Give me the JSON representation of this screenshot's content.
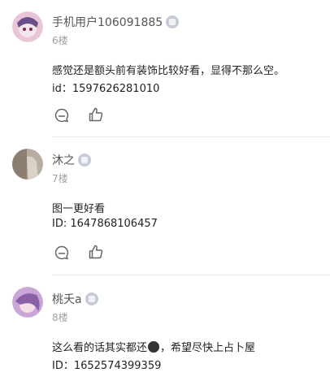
{
  "comments": [
    {
      "username": "手机用户106091885",
      "floor": "6楼",
      "body": "感觉还是额头前有装饰比较好看，显得不那么空。",
      "id_line": "id：1597626281010",
      "avatar_color": "#e8c6d8",
      "icons": {
        "badge": "level-badge-icon",
        "reply": "comment-bubble-icon",
        "like": "thumbs-up-icon"
      }
    },
    {
      "username": "沐之",
      "floor": "7楼",
      "body": "图一更好看",
      "id_line": "ID:   1647868106457",
      "avatar_color": "#b9ad9f",
      "icons": {
        "badge": "level-badge-icon",
        "reply": "comment-bubble-icon",
        "like": "thumbs-up-icon"
      }
    },
    {
      "username": "桃夭a",
      "floor": "8楼",
      "body_before": "这么看的话其实都还",
      "body_after": "，希望尽快上占卜屋",
      "id_line": " ID：1652574399359",
      "avatar_color": "#c9a6d6",
      "icons": {
        "badge": "level-badge-icon",
        "emoji": "emoji-face-icon"
      }
    }
  ],
  "colors": {
    "divider": "#ececec",
    "badge": "#c6ccd6",
    "icon_stroke": "#666666"
  }
}
